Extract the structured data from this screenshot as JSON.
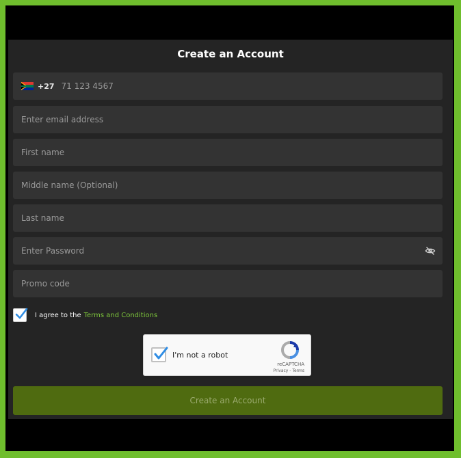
{
  "form": {
    "title": "Create an Account",
    "phone_code": "+27",
    "phone_placeholder": "71 123 4567",
    "email_placeholder": "Enter email address",
    "first_name_placeholder": "First name",
    "middle_name_placeholder": "Middle name (Optional)",
    "last_name_placeholder": "Last name",
    "password_placeholder": "Enter Password",
    "promo_placeholder": "Promo code",
    "agree_text": "I agree to the",
    "terms_link": "Terms and Conditions",
    "submit_label": "Create an Account"
  },
  "recaptcha": {
    "label": "I'm not a robot",
    "brand": "reCAPTCHA",
    "links": "Privacy - Terms"
  },
  "colors": {
    "accent_green": "#6fbe2d",
    "link_green": "#7dc53b",
    "button_green": "#4f6b10",
    "panel": "#242424",
    "field": "#333333"
  }
}
